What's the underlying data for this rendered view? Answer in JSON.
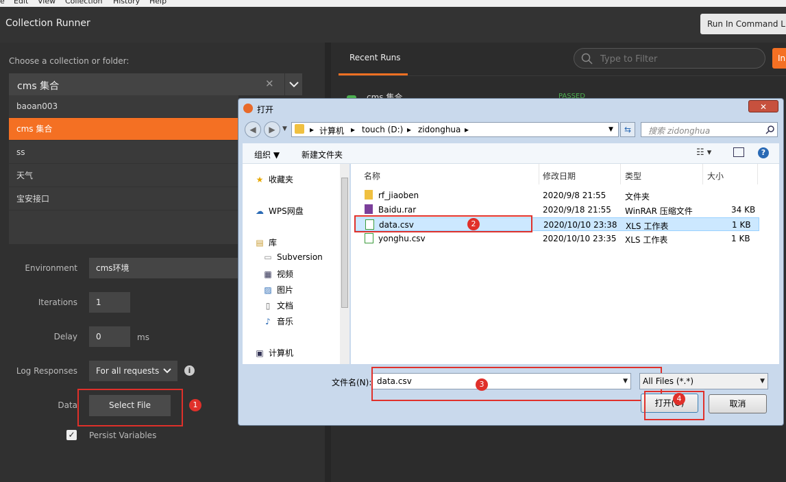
{
  "menu": [
    "e",
    "Edit",
    "View",
    "Collection",
    "History",
    "Help"
  ],
  "header": {
    "title": "Collection Runner",
    "run_cmd_label": "Run In Command Line"
  },
  "runner": {
    "choose_label": "Choose a collection or folder:",
    "selected_collection": "cms 集合",
    "collections": [
      "baoan003",
      "cms 集合",
      "ss",
      "天气",
      "宝安接口"
    ],
    "environment_label": "Environment",
    "environment_value": "cms环境",
    "iterations_label": "Iterations",
    "iterations_value": "1",
    "delay_label": "Delay",
    "delay_value": "0",
    "delay_unit": "ms",
    "log_label": "Log Responses",
    "log_value": "For all requests",
    "data_label": "Data",
    "select_file_label": "Select File",
    "persist_label": "Persist Variables"
  },
  "recent": {
    "tab_label": "Recent Runs",
    "filter_placeholder": "Type to Filter",
    "action_label": "In",
    "run_name": "cms 集合",
    "run_status": "PASSED"
  },
  "annotations": [
    "1",
    "2",
    "3",
    "4"
  ],
  "dialog": {
    "title": "打开",
    "path": [
      "计算机",
      "touch (D:)",
      "zidonghua"
    ],
    "search_placeholder": "搜索 zidonghua",
    "organize_label": "组织 ▼",
    "new_folder_label": "新建文件夹",
    "nav": {
      "favorites": "收藏夹",
      "wps": "WPS网盘",
      "library": "库",
      "subversion": "Subversion",
      "video": "视频",
      "pictures": "图片",
      "docs": "文档",
      "music": "音乐",
      "computer": "计算机"
    },
    "columns": {
      "name": "名称",
      "modified": "修改日期",
      "type": "类型",
      "size": "大小"
    },
    "files": [
      {
        "name": "rf_jiaoben",
        "modified": "2020/9/8 21:55",
        "type": "文件夹",
        "size": ""
      },
      {
        "name": "Baidu.rar",
        "modified": "2020/9/18 21:55",
        "type": "WinRAR 压缩文件",
        "size": "34 KB"
      },
      {
        "name": "data.csv",
        "modified": "2020/10/10 23:38",
        "type": "XLS 工作表",
        "size": "1 KB"
      },
      {
        "name": "yonghu.csv",
        "modified": "2020/10/10 23:35",
        "type": "XLS 工作表",
        "size": "1 KB"
      }
    ],
    "filename_label": "文件名(N):",
    "filename_value": "data.csv",
    "filetype_value": "All Files (*.*)",
    "open_label": "打开(O)",
    "cancel_label": "取消"
  },
  "colors": {
    "accent": "#f47023",
    "annotation_red": "#e0302a",
    "passed": "#4caf50"
  }
}
